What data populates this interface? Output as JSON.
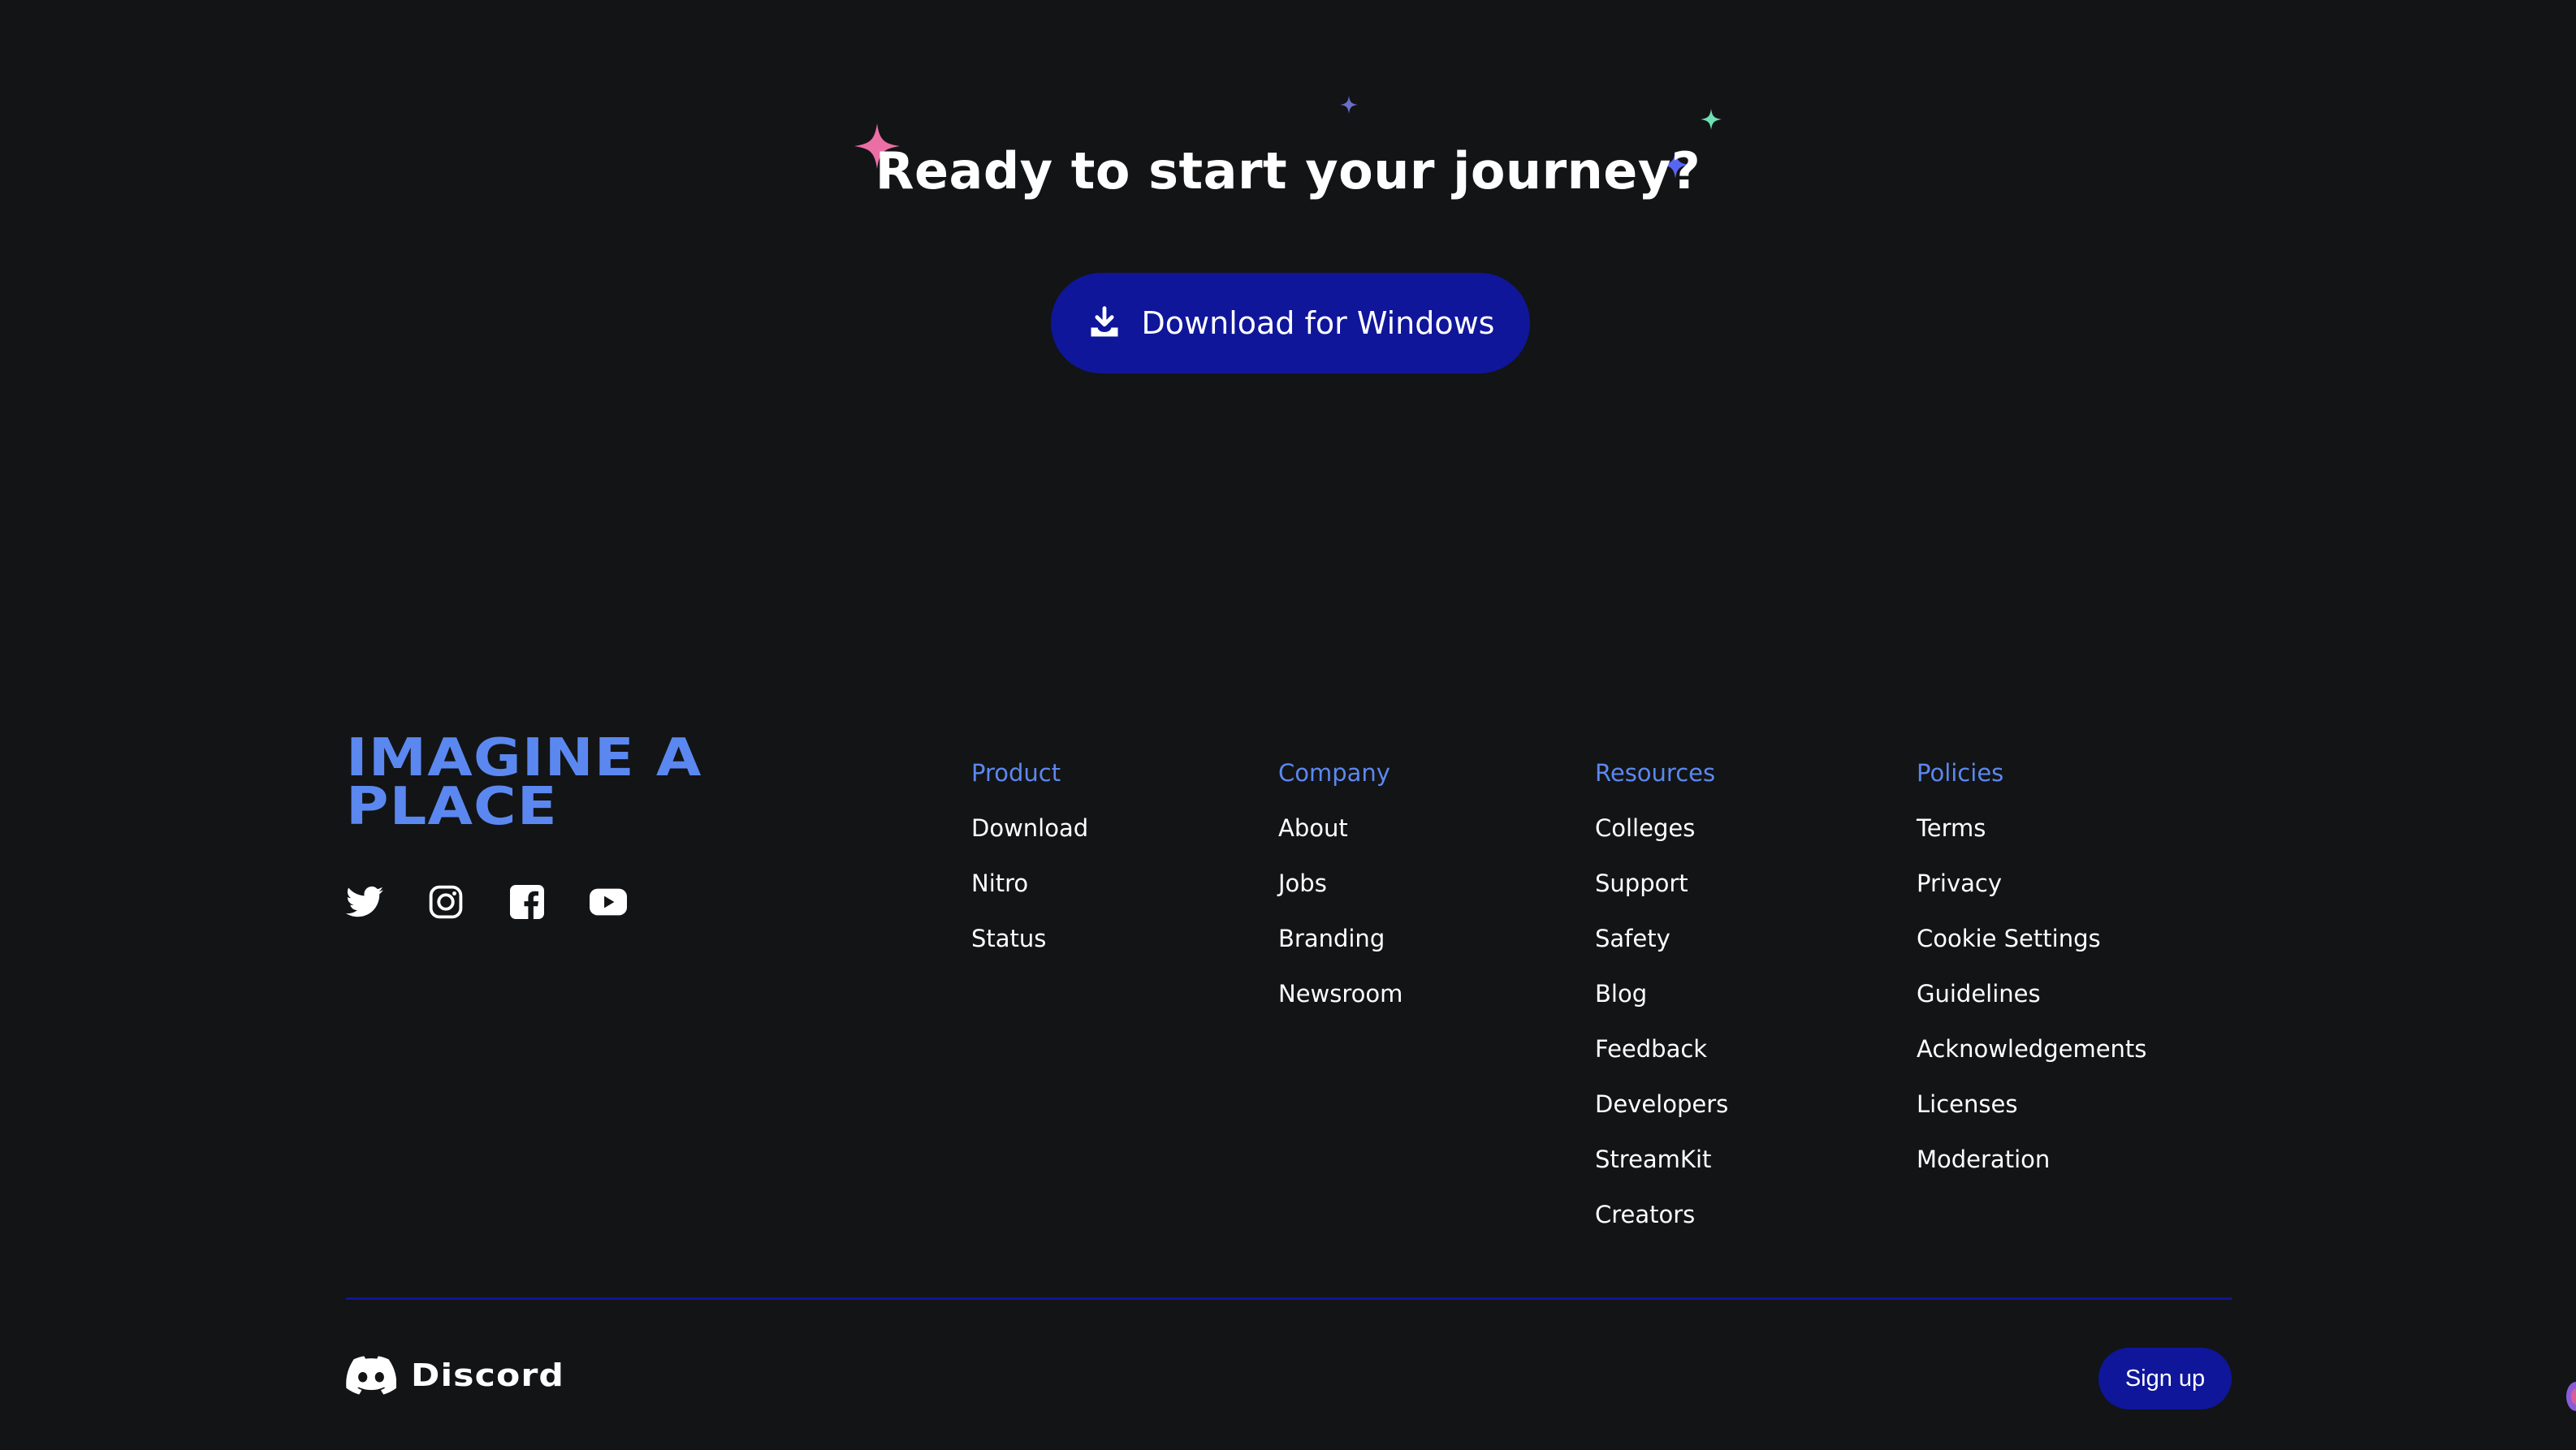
{
  "cta": {
    "title": "Ready to start your journey?",
    "download_label": "Download for Windows",
    "download_icon": "download-icon"
  },
  "brand": {
    "title_line1": "IMAGINE A",
    "title_line2": "PLACE"
  },
  "socials": [
    {
      "name": "twitter-icon"
    },
    {
      "name": "instagram-icon"
    },
    {
      "name": "facebook-icon"
    },
    {
      "name": "youtube-icon"
    }
  ],
  "columns": {
    "product": {
      "heading": "Product",
      "links": [
        "Download",
        "Nitro",
        "Status"
      ]
    },
    "company": {
      "heading": "Company",
      "links": [
        "About",
        "Jobs",
        "Branding",
        "Newsroom"
      ]
    },
    "resources": {
      "heading": "Resources",
      "links": [
        "Colleges",
        "Support",
        "Safety",
        "Blog",
        "Feedback",
        "Developers",
        "StreamKit",
        "Creators"
      ]
    },
    "policies": {
      "heading": "Policies",
      "links": [
        "Terms",
        "Privacy",
        "Cookie Settings",
        "Guidelines",
        "Acknowledgements",
        "Licenses",
        "Moderation"
      ]
    }
  },
  "footer": {
    "wordmark": "Discord",
    "signup_label": "Sign up"
  },
  "colors": {
    "background": "#131416",
    "accent_button": "#0f169a",
    "heading_blue": "#5b88f0",
    "sparkle_pink": "#eb6ea5",
    "sparkle_blue": "#5865f2",
    "sparkle_teal": "#6fe0b4"
  }
}
